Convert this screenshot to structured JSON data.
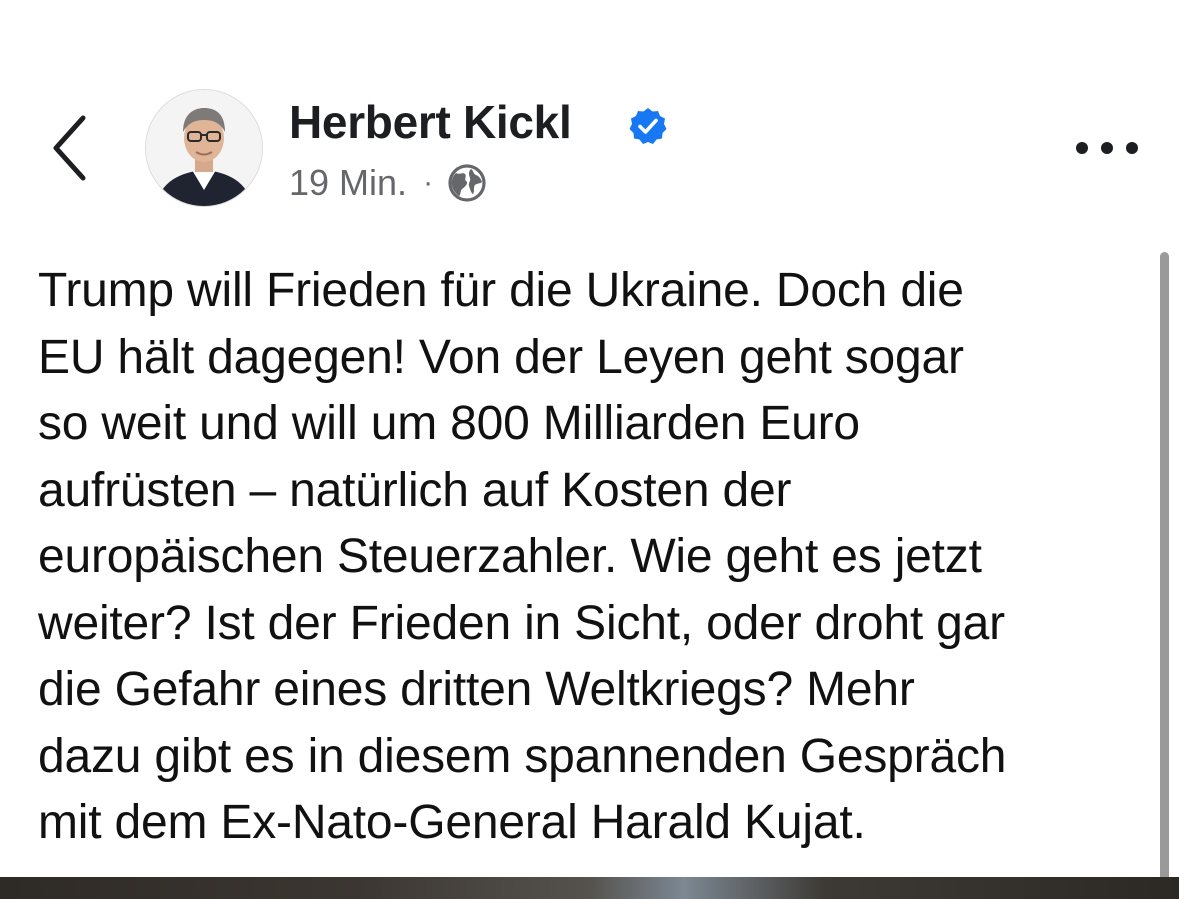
{
  "post": {
    "author_name": "Herbert Kickl",
    "verified": true,
    "timestamp": "19 Min.",
    "separator": "·",
    "audience_icon": "globe-icon",
    "body_lines": [
      "Trump will Frieden für die Ukraine. Doch die",
      "EU hält dagegen! Von der Leyen geht sogar",
      "so weit und will um 800 Milliarden Euro",
      "aufrüsten – natürlich auf Kosten der",
      "europäischen Steuerzahler. Wie geht es jetzt",
      "weiter? Ist der Frieden in Sicht, oder droht gar",
      "die Gefahr eines dritten Weltkriegs? Mehr",
      "dazu gibt es in diesem spannenden Gespräch",
      "mit dem Ex-Nato-General Harald Kujat."
    ]
  },
  "header": {
    "back_icon": "chevron-left-icon",
    "more_icon": "more-horizontal-icon"
  },
  "colors": {
    "verified_blue": "#1877f2",
    "name_text": "#1c1e21",
    "meta_gray": "#65676b",
    "body_text": "#111111"
  }
}
